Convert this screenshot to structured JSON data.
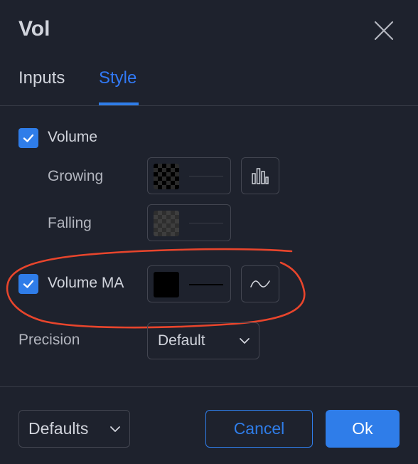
{
  "dialog": {
    "title": "Vol"
  },
  "tabs": [
    {
      "label": "Inputs",
      "active": false
    },
    {
      "label": "Style",
      "active": true
    }
  ],
  "style": {
    "volume": {
      "label": "Volume",
      "checked": true
    },
    "growing": {
      "label": "Growing",
      "color": "#000000"
    },
    "falling": {
      "label": "Falling",
      "color": "#000000"
    },
    "volume_ma": {
      "label": "Volume MA",
      "checked": true,
      "color": "#000000",
      "line_color": "#000000"
    },
    "precision": {
      "label": "Precision",
      "value": "Default"
    }
  },
  "footer": {
    "defaults_label": "Defaults",
    "cancel_label": "Cancel",
    "ok_label": "Ok"
  },
  "colors": {
    "background": "#1e222d",
    "accent": "#2f7de9",
    "annotation": "#e8452c"
  },
  "icons": {
    "close": "close-icon",
    "columns": "columns-icon",
    "wave": "line-style-icon",
    "chevron": "chevron-down-icon",
    "check": "checkmark-icon"
  }
}
